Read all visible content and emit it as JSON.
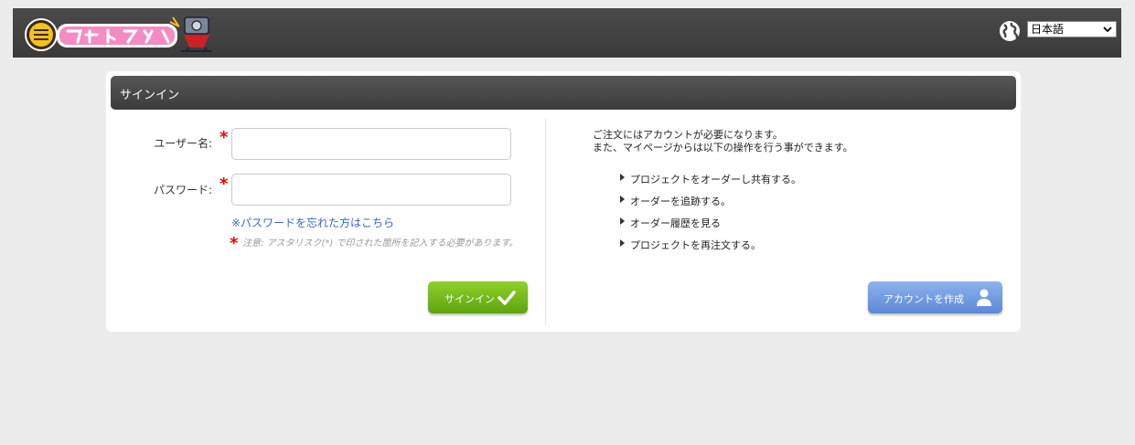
{
  "header": {
    "logo_text": "撮るだけフォトブック",
    "language": {
      "selected": "日本語"
    }
  },
  "card": {
    "title": "サインイン"
  },
  "form": {
    "username_label": "ユーザー名:",
    "password_label": "パスワード:",
    "required_mark": "*",
    "username_value": "",
    "password_value": "",
    "forgot_link": "※パスワードを忘れた方はこちら",
    "note": "注意: アスタリスク(*) で印された箇所を記入する必要があります。",
    "signin_button": "サインイン"
  },
  "info": {
    "line1": "ご注文にはアカウントが必要になります。",
    "line2": "また、マイページからは以下の操作を行う事ができます。",
    "items": [
      "プロジェクトをオーダーし共有する。",
      "オーダーを追跡する。",
      "オーダー履歴を見る",
      "プロジェクトを再注文する。"
    ],
    "create_button": "アカウントを作成"
  },
  "colors": {
    "header_bg": "#404040",
    "signin_green": "#6fb81a",
    "create_blue": "#6f98e0",
    "link_blue": "#3a66c8",
    "required_red": "#e00000"
  }
}
